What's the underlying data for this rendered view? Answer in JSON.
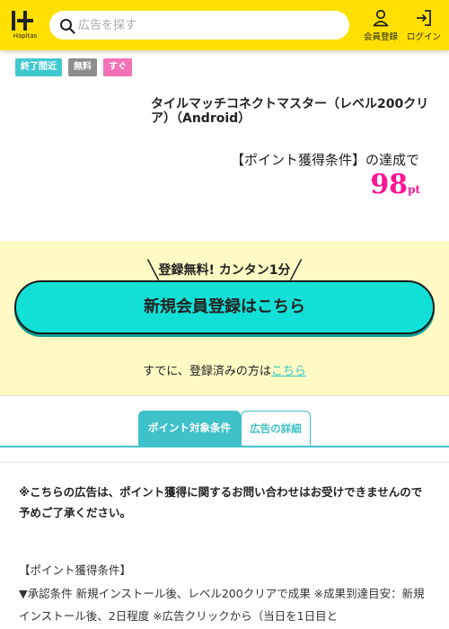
{
  "header": {
    "logo_text": "Hapitas",
    "search_placeholder": "広告を探す",
    "register_label": "会員登録",
    "login_label": "ログイン",
    "colors": {
      "background": "#ffe000"
    }
  },
  "tags": [
    {
      "label": "終了間近",
      "color": "#40c8cf"
    },
    {
      "label": "無料",
      "color": "#8e8e8e"
    },
    {
      "label": "すぐ",
      "color": "#f472b6"
    }
  ],
  "ad": {
    "title": "タイルマッチコネクトマスター（レベル200クリア）（Android）",
    "condition_text": "【ポイント獲得条件】の達成で",
    "points_value": "98",
    "points_unit": "pt",
    "points_color": "#ff1493"
  },
  "registration": {
    "catch": "登録無料! カンタン1分",
    "slash_left": "╲",
    "slash_right": "╱",
    "button_label": "新規会員登録はこちら",
    "already_text": "すでに、登録済みの方は",
    "already_link": "こちら",
    "colors": {
      "background": "#fff9c4",
      "button": "#12e0d6"
    }
  },
  "tabs": [
    {
      "label": "ポイント対象条件",
      "active": true
    },
    {
      "label": "広告の詳細",
      "active": false
    }
  ],
  "content": {
    "notice": "※こちらの広告は、ポイント獲得に関するお問い合わせはお受けできませんので予めご了承ください。",
    "condition_heading": "【ポイント獲得条件】",
    "condition_body": "▼承認条件 新規インストール後、レベル200クリアで成果 ※成果到達目安：新規インストール後、2日程度 ※広告クリックから（当日を1日目と"
  }
}
